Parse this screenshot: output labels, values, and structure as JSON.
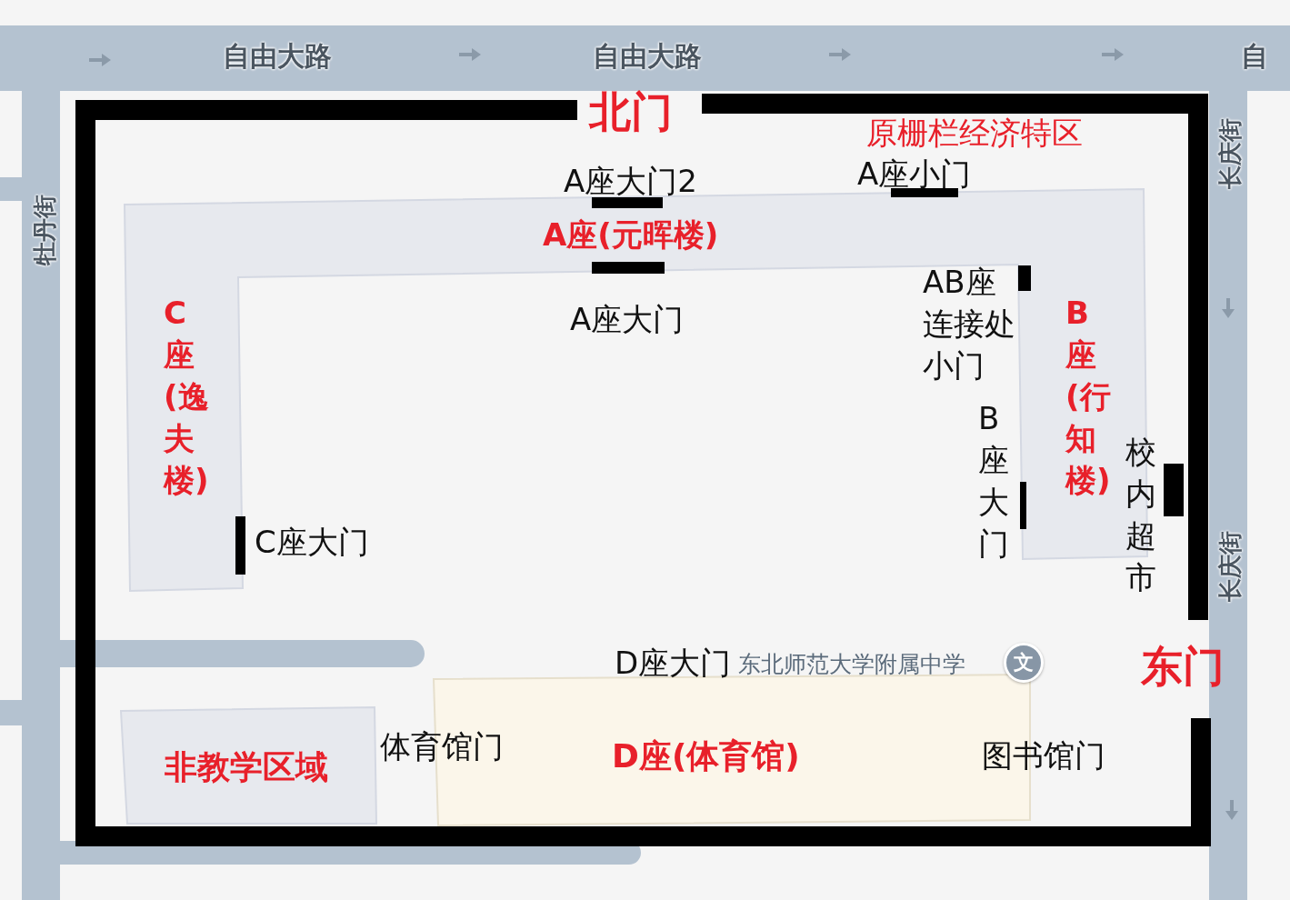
{
  "map": {
    "street_labels": [
      "自由大路",
      "自由大路",
      "自",
      "长庆街",
      "长庆街",
      "牡丹街"
    ],
    "poi": {
      "name": "东北师范大学附属中学",
      "icon_text": "文"
    }
  },
  "gates": [
    {
      "label": "北门"
    },
    {
      "label": "东门"
    }
  ],
  "note": "原栅栏经济特区",
  "buildings": [
    {
      "label": "A座(元晖楼)",
      "kind": "horizontal"
    },
    {
      "label": "C座(逸夫楼)",
      "kind": "vertical"
    },
    {
      "label": "B座(行知楼)",
      "kind": "vertical"
    },
    {
      "label": "D座(体育馆)",
      "kind": "horizontal"
    },
    {
      "label": "非教学区域",
      "kind": "horizontal"
    }
  ],
  "doors": [
    {
      "label": "A座大门2",
      "kind": "horizontal"
    },
    {
      "label": "A座小门",
      "kind": "horizontal"
    },
    {
      "label": "A座大门",
      "kind": "horizontal"
    },
    {
      "label": "AB座连接处小门",
      "kind": "block"
    },
    {
      "label": "B座大门",
      "kind": "vertical"
    },
    {
      "label": "校内超市",
      "kind": "vertical"
    },
    {
      "label": "C座大门",
      "kind": "horizontal"
    },
    {
      "label": "体育馆门",
      "kind": "horizontal"
    },
    {
      "label": "图书馆门",
      "kind": "horizontal"
    },
    {
      "label": "D座大门",
      "kind": "horizontal"
    }
  ]
}
